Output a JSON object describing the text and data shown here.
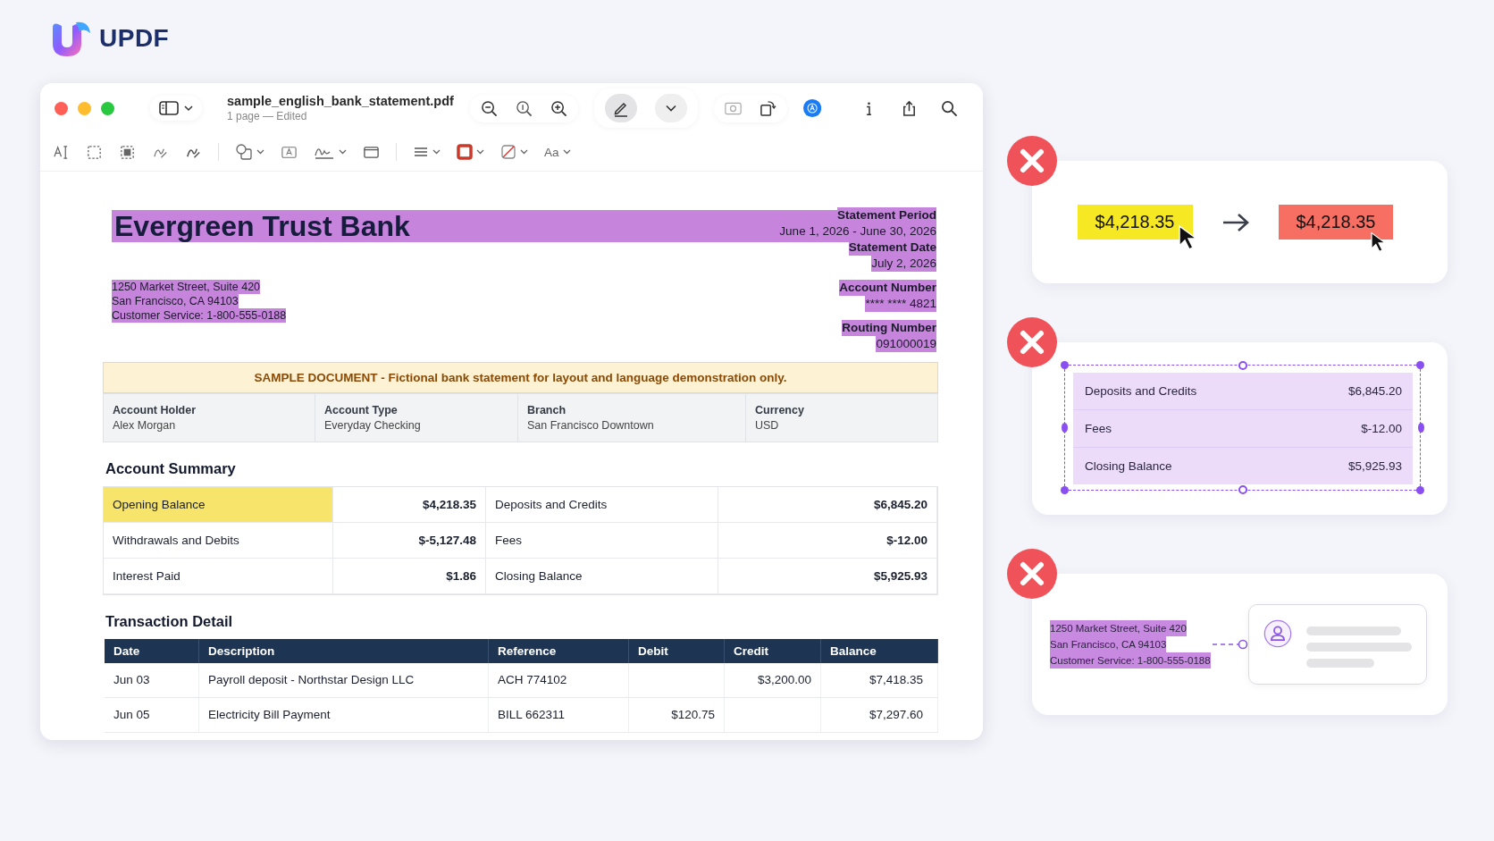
{
  "brand": {
    "name": "UPDF"
  },
  "window": {
    "title": "sample_english_bank_statement.pdf",
    "subtitle": "1 page — Edited",
    "pen_selected": true,
    "font_button": "Aa"
  },
  "document": {
    "bank_name": "Evergreen Trust Bank",
    "statement_info": [
      {
        "label": "Statement Period",
        "value": "June 1, 2026 - June 30, 2026"
      },
      {
        "label": "Statement Date",
        "value": "July 2, 2026"
      },
      {
        "label": "Account Number",
        "value": "**** **** 4821"
      },
      {
        "label": "Routing Number",
        "value": "091000019"
      }
    ],
    "address": [
      "1250 Market Street, Suite 420",
      "San Francisco, CA 94103",
      "Customer Service: 1-800-555-0188"
    ],
    "notice": "SAMPLE DOCUMENT - Fictional bank statement for layout and language demonstration only.",
    "account_fields": [
      {
        "label": "Account Holder",
        "value": "Alex Morgan"
      },
      {
        "label": "Account Type",
        "value": "Everyday Checking"
      },
      {
        "label": "Branch",
        "value": "San Francisco Downtown"
      },
      {
        "label": "Currency",
        "value": "USD"
      }
    ],
    "summary_title": "Account Summary",
    "summary_rows": [
      [
        {
          "label": "Opening Balance",
          "amount": "$4,218.35",
          "highlighted": true
        },
        {
          "label": "Deposits and Credits",
          "amount": "$6,845.20",
          "highlighted": false
        }
      ],
      [
        {
          "label": "Withdrawals and Debits",
          "amount": "$-5,127.48",
          "highlighted": false
        },
        {
          "label": "Fees",
          "amount": "$-12.00",
          "highlighted": false
        }
      ],
      [
        {
          "label": "Interest Paid",
          "amount": "$1.86",
          "highlighted": false
        },
        {
          "label": "Closing Balance",
          "amount": "$5,925.93",
          "highlighted": false
        }
      ]
    ],
    "transactions_title": "Transaction Detail",
    "transactions": {
      "columns": [
        "Date",
        "Description",
        "Reference",
        "Debit",
        "Credit",
        "Balance"
      ],
      "rows": [
        [
          "Jun 03",
          "Payroll deposit - Northstar Design LLC",
          "ACH 774102",
          "",
          "$3,200.00",
          "$7,418.35"
        ],
        [
          "Jun 05",
          "Electricity Bill Payment",
          "BILL 662311",
          "$120.75",
          "",
          "$7,297.60"
        ]
      ]
    }
  },
  "examples": [
    {
      "kind": "recolor",
      "before": "$4,218.35",
      "after": "$4,218.35"
    },
    {
      "kind": "selection",
      "rows": [
        {
          "label": "Deposits and Credits",
          "amount": "$6,845.20"
        },
        {
          "label": "Fees",
          "amount": "$-12.00"
        },
        {
          "label": "Closing Balance",
          "amount": "$5,925.93"
        }
      ]
    },
    {
      "kind": "link",
      "lines": [
        "1250 Market Street, Suite 420",
        "San Francisco, CA 94103",
        "Customer Service: 1-800-555-0188"
      ]
    }
  ]
}
